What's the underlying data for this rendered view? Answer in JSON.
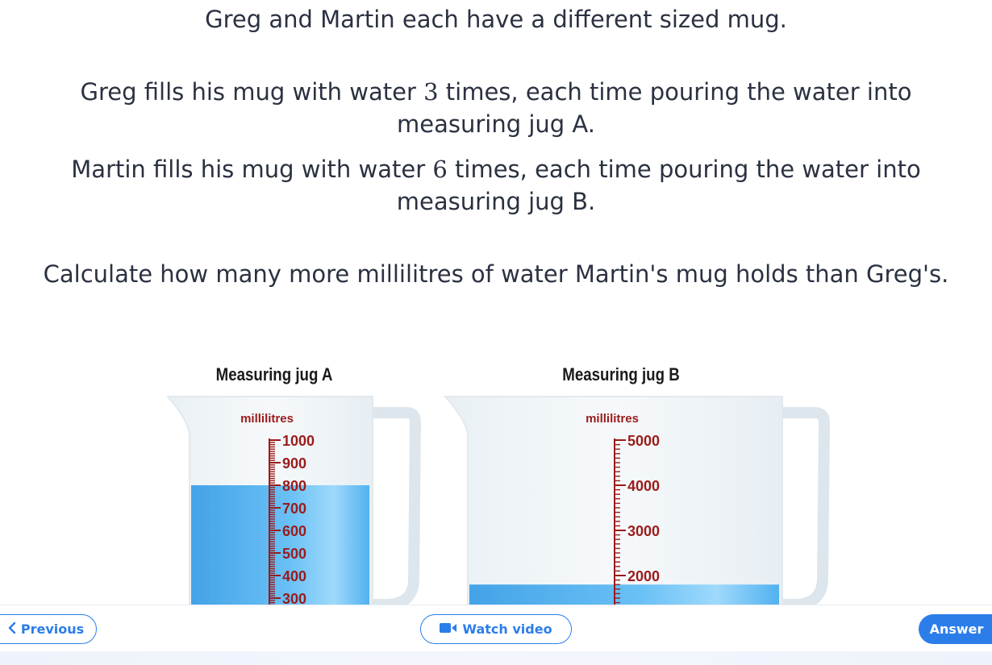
{
  "question": {
    "p1": "Greg and Martin each have a different sized mug.",
    "p2_before": "Greg fills his mug with water ",
    "p2_num": "3",
    "p2_after": " times, each time pouring the water into measuring jug A.",
    "p3_before": "Martin fills his mug with water ",
    "p3_num": "6",
    "p3_after": " times, each time pouring the water into measuring jug B.",
    "p4": "Calculate how many more millilitres of water Martin's mug holds than Greg's."
  },
  "jug_a": {
    "title": "Measuring jug A",
    "unit": "millilitres",
    "labels": [
      "1000",
      "900",
      "800",
      "700",
      "600",
      "500",
      "400",
      "300"
    ],
    "water_level_ml": 800
  },
  "jug_b": {
    "title": "Measuring jug B",
    "unit": "millilitres",
    "labels": [
      "5000",
      "4000",
      "3000",
      "2000"
    ],
    "water_level_ml": 1800
  },
  "colors": {
    "water": "#4aaef0",
    "scale": "#9b1b1b",
    "accent": "#2b7de9"
  },
  "footer": {
    "previous_label": "Previous",
    "video_label": "Watch video",
    "answer_label": "Answer"
  },
  "icons": {
    "previous": "chevron-left-icon",
    "video": "video-camera-icon"
  }
}
